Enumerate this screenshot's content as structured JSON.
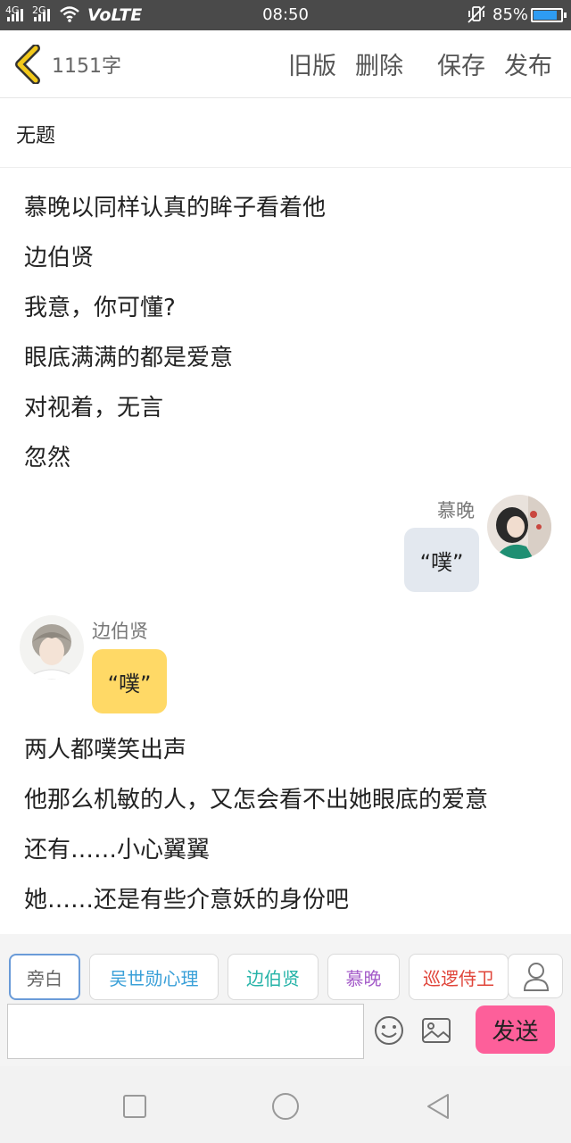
{
  "status_bar": {
    "network_1": "4G",
    "network_2": "2G",
    "carrier_label": "VoLTE",
    "time": "08:50",
    "battery_percent": "85%",
    "battery_level": 0.85
  },
  "top_bar": {
    "word_count": "1151字",
    "actions": [
      "旧版",
      "删除",
      "保存",
      "发布"
    ]
  },
  "title": "无题",
  "lines_before": [
    "慕晚以同样认真的眸子看着他",
    "边伯贤",
    "我意，你可懂?",
    "眼底满满的都是爱意",
    "对视着，无言",
    "忽然"
  ],
  "messages": [
    {
      "side": "right",
      "speaker": "慕晚",
      "text": "“噗”",
      "bubble_color": "#e3e8ef"
    },
    {
      "side": "left",
      "speaker": "边伯贤",
      "text": "“噗”",
      "bubble_color": "#ffd966"
    }
  ],
  "lines_after": [
    "两人都噗笑出声",
    "他那么机敏的人，又怎会看不出她眼底的爱意",
    "还有……小心翼翼",
    "她……还是有些介意妖的身份吧"
  ],
  "character_tabs": [
    {
      "label": "旁白",
      "color": "#666666",
      "selected": true
    },
    {
      "label": "吴世勋心理",
      "color": "#3aa0d8",
      "selected": false
    },
    {
      "label": "边伯贤",
      "color": "#25b3a8",
      "selected": false
    },
    {
      "label": "慕晚",
      "color": "#a45cc9",
      "selected": false
    },
    {
      "label": "巡逻侍卫",
      "color": "#e0453a",
      "selected": false
    }
  ],
  "input": {
    "value": "",
    "placeholder": ""
  },
  "send_label": "发送",
  "colors": {
    "accent": "#fd5f9a",
    "selected_tab_border": "#6a9bd8",
    "back_arrow": "#f2c91b"
  }
}
